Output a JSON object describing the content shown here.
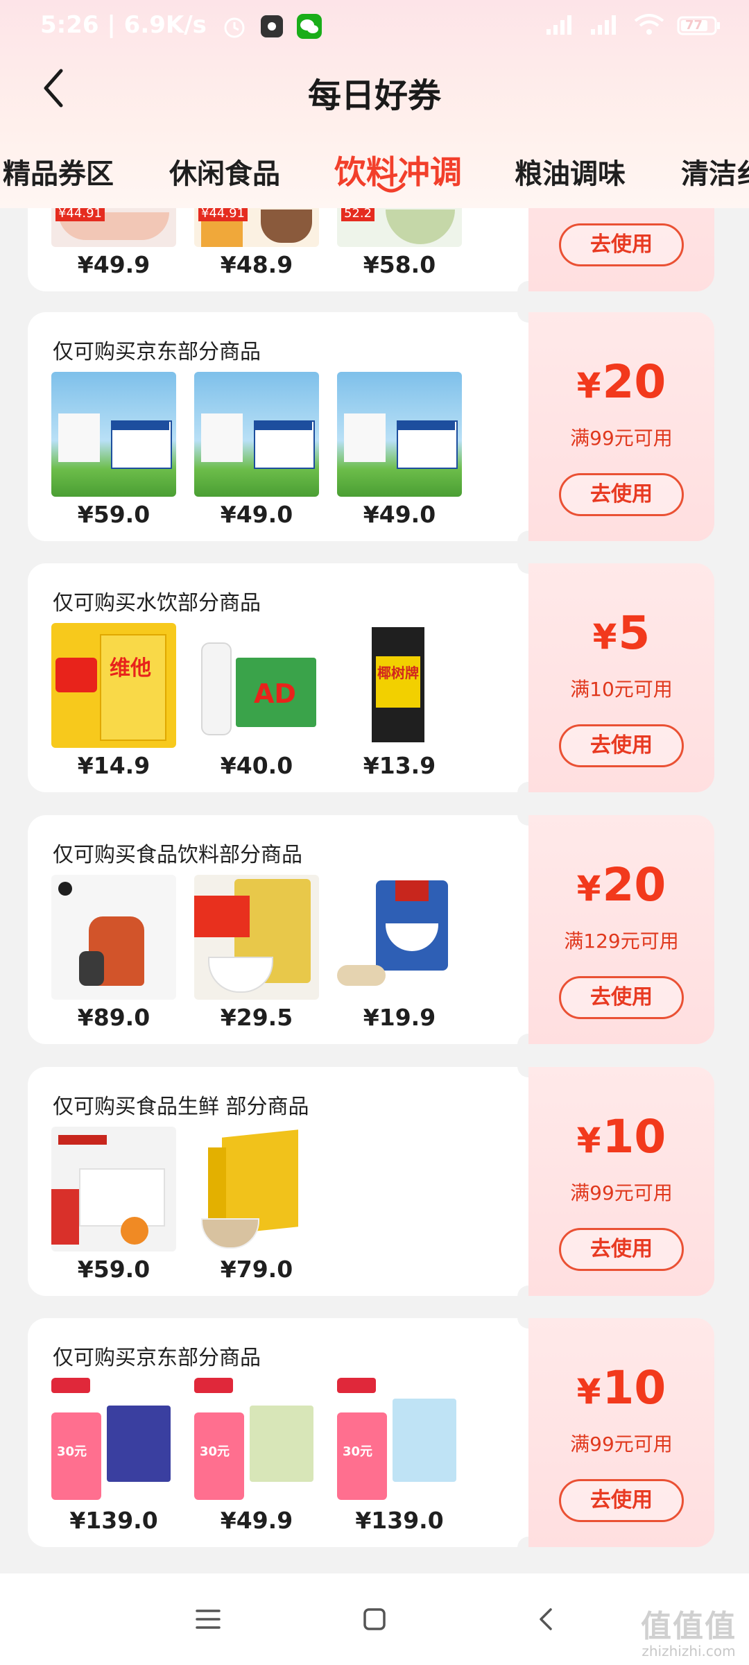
{
  "status_bar": {
    "time": "5:26 | 6.9K/s",
    "battery": "77"
  },
  "header": {
    "title": "每日好券"
  },
  "tabs": [
    {
      "label": "精品券区",
      "active": false
    },
    {
      "label": "休闲食品",
      "active": false
    },
    {
      "label": "饮料冲调",
      "active": true
    },
    {
      "label": "粮油调味",
      "active": false
    },
    {
      "label": "清洁纟",
      "active": false
    }
  ],
  "colors": {
    "accent": "#f23f2b",
    "coupon_bg": "#ffe4e5",
    "page_bg": "#f2f2f2"
  },
  "coupons": [
    {
      "title": "",
      "products": [
        {
          "price": "¥49.9",
          "tag": "¥44.91",
          "image": "drink-bowl"
        },
        {
          "price": "¥48.9",
          "tag": "¥44.91",
          "image": "coffee-cup"
        },
        {
          "price": "¥58.0",
          "tag": "52.2",
          "image": "tea-bowl"
        }
      ],
      "amount": "",
      "condition": "",
      "button": "去使用"
    },
    {
      "title": "仅可购买京东部分商品",
      "products": [
        {
          "price": "¥59.0",
          "image": "milk-box"
        },
        {
          "price": "¥49.0",
          "image": "milk-box"
        },
        {
          "price": "¥49.0",
          "image": "milk-box"
        }
      ],
      "amount_symbol": "¥",
      "amount": "20",
      "condition": "满99元可用",
      "button": "去使用"
    },
    {
      "title": "仅可购买水饮部分商品",
      "products": [
        {
          "price": "¥14.9",
          "image": "lemon-tea-box",
          "box_text": "维他"
        },
        {
          "price": "¥40.0",
          "image": "ad-calcium-milk",
          "box_text": "AD"
        },
        {
          "price": "¥13.9",
          "image": "coconut-juice",
          "box_text": "椰树牌"
        }
      ],
      "amount_symbol": "¥",
      "amount": "5",
      "condition": "满10元可用",
      "button": "去使用"
    },
    {
      "title": "仅可购买食品饮料部分商品",
      "products": [
        {
          "price": "¥89.0",
          "image": "instant-coffee"
        },
        {
          "price": "¥29.5",
          "image": "oat-cereal-bag"
        },
        {
          "price": "¥19.9",
          "image": "quaker-oats"
        }
      ],
      "amount_symbol": "¥",
      "amount": "20",
      "condition": "满129元可用",
      "button": "去使用"
    },
    {
      "title": "仅可购买食品生鲜 部分商品",
      "products": [
        {
          "price": "¥59.0",
          "image": "coffee-box"
        },
        {
          "price": "¥79.0",
          "image": "cappuccino-box"
        }
      ],
      "amount_symbol": "¥",
      "amount": "10",
      "condition": "满99元可用",
      "button": "去使用"
    },
    {
      "title": "仅可购买京东部分商品",
      "products": [
        {
          "price": "¥139.0",
          "tag": "30元",
          "image": "milk-promo"
        },
        {
          "price": "¥49.9",
          "tag": "30元",
          "image": "milk-promo"
        },
        {
          "price": "¥139.0",
          "tag": "30元",
          "image": "milk-promo"
        }
      ],
      "amount_symbol": "¥",
      "amount": "10",
      "condition": "满99元可用",
      "button": "去使用"
    }
  ],
  "bottom_nav": {
    "watermark": "值值值",
    "watermark_url": "zhizhizhi.com"
  }
}
